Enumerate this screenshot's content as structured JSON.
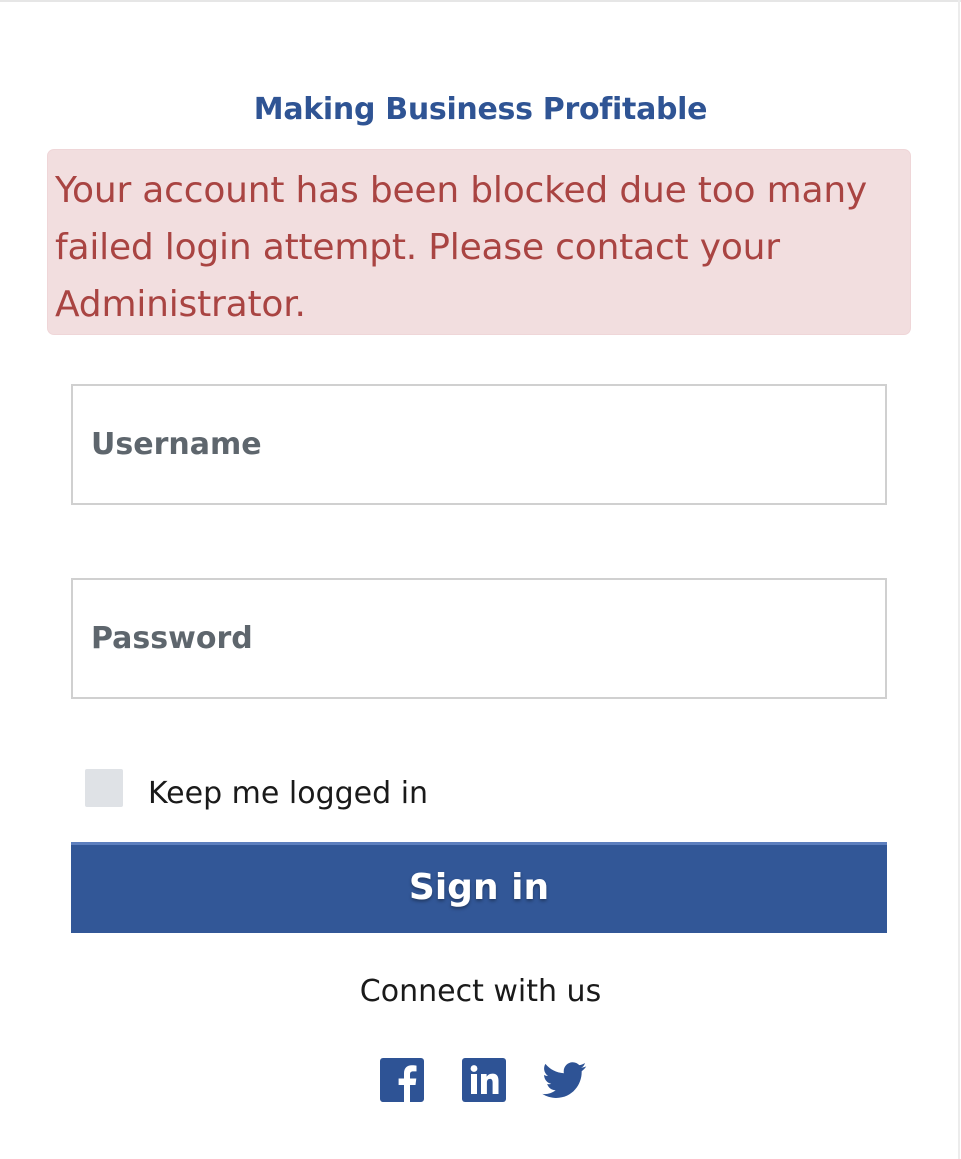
{
  "header": {
    "tagline": "Making Business Profitable"
  },
  "alert": {
    "message": "Your account has been blocked due too many failed login attempt. Please contact your Administrator."
  },
  "form": {
    "username_placeholder": "Username",
    "password_placeholder": "Password",
    "username_value": "",
    "password_value": "",
    "keep_logged_in_label": "Keep me logged in",
    "keep_logged_in_checked": false,
    "signin_label": "Sign in"
  },
  "footer": {
    "connect_label": "Connect with us",
    "social": [
      {
        "icon": "facebook-icon"
      },
      {
        "icon": "linkedin-icon"
      },
      {
        "icon": "twitter-icon"
      }
    ]
  },
  "colors": {
    "brand_blue": "#325797",
    "tagline_blue": "#2f5494",
    "alert_background": "#f2dedf",
    "alert_text": "#a94442",
    "social_icon": "#2e5395"
  }
}
